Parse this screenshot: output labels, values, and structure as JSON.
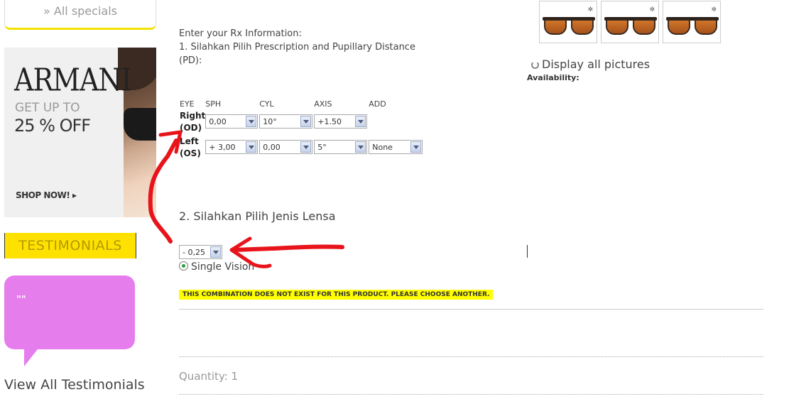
{
  "sidebar": {
    "specials_link": "» All specials",
    "banner": {
      "brand": "ARMANI",
      "line1": "GET UP TO",
      "line2": "25 % OFF",
      "cta": "SHOP NOW! ▸"
    },
    "testimonials_heading": "TESTIMONIALS",
    "testimonial_quote": "\"\"",
    "view_all": "View All Testimonials"
  },
  "rx": {
    "intro": "Enter your Rx Information:",
    "step1": "1. Silahkan Pilih Prescription and Pupillary Distance (PD):",
    "headers": [
      "EYE",
      "SPH",
      "CYL",
      "AXIS",
      "ADD"
    ],
    "right_label": "Right (OD)",
    "left_label": "Left (OS)",
    "right": {
      "sph": "0,00",
      "cyl": "10°",
      "axis": "+1.50"
    },
    "left": {
      "sph": "+ 3,00",
      "cyl": "0,00",
      "axis": "5°",
      "add": "None"
    }
  },
  "lens": {
    "step2": "2. Silahkan Pilih Jenis Lensa",
    "selected": "- 0,25",
    "option": "Single Vision"
  },
  "warning": "THIS COMBINATION DOES NOT EXIST FOR THIS PRODUCT. PLEASE CHOOSE ANOTHER.",
  "quantity": "Quantity: 1",
  "gallery": {
    "display_all": "Display all pictures",
    "availability": "Availability:"
  },
  "colors": {
    "highlight_yellow": "#ffff00",
    "testimonial_bubble": "#e67ded",
    "annotation_red": "#e8141b"
  },
  "icons": [
    "loading-icon",
    "radio-selected-icon",
    "dropdown-arrow-icon",
    "brand-logo-icon"
  ]
}
